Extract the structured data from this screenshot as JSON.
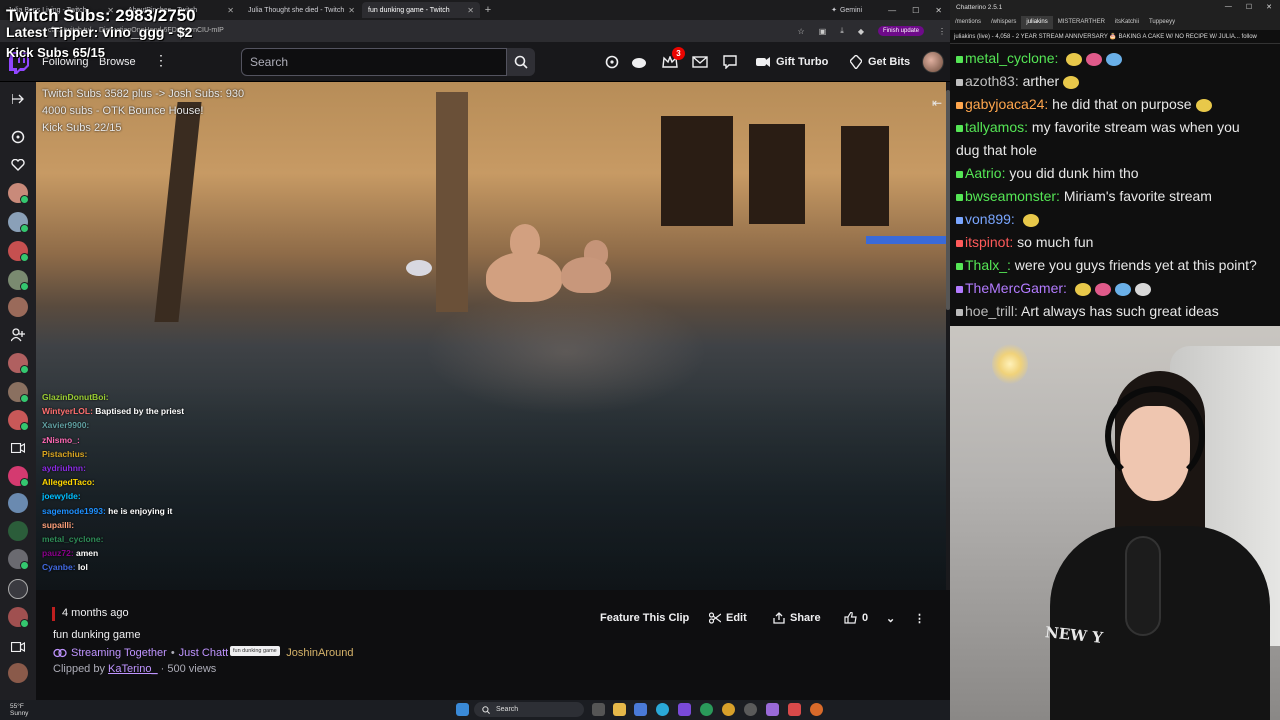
{
  "overlay": {
    "twitch_subs": "Twitch Subs: 2983/2750",
    "latest_tipper": "Latest Tipper: vino_ggg - $2",
    "kick_subs": "Kick Subs 65/15"
  },
  "browser": {
    "tabs": [
      {
        "label": "Julia Bops Living - Twitch",
        "active": false
      },
      {
        "label": "AboutPinches - Twitch",
        "active": false
      },
      {
        "label": "Julia Thought she died - Twitch",
        "active": false
      },
      {
        "label": "fun dunking game - Twitch",
        "active": true
      }
    ],
    "gemini_label": "Gemini",
    "url": "clips.twitch.tv/... DistinctionOneHand-6FDzloaznCIU-mIP",
    "finish_update_label": "Finish update"
  },
  "twitch_nav": {
    "following": "Following",
    "browse": "Browse",
    "search_placeholder": "Search",
    "notification_count": "3",
    "gift_turbo": "Gift Turbo",
    "get_bits": "Get Bits"
  },
  "video": {
    "overlay_lines": [
      "Twitch Subs 3582   plus -> Josh Subs: 930",
      "4000 subs - OTK Bounce House!",
      "Kick Subs 22/15"
    ],
    "chat": [
      {
        "user": "GlazinDonutBoi:",
        "msg": "",
        "color": "#9acd32"
      },
      {
        "user": "WintyerLOL:",
        "msg": "Baptised by the priest",
        "color": "#ff6f6f"
      },
      {
        "user": "Xavier9900:",
        "msg": "",
        "color": "#5f9ea0"
      },
      {
        "user": "zNismo_:",
        "msg": "",
        "color": "#ff69b4"
      },
      {
        "user": "Pistachius:",
        "msg": "",
        "color": "#daa520"
      },
      {
        "user": "aydriuhnn:",
        "msg": "",
        "color": "#8a2be2"
      },
      {
        "user": "AllegedTaco:",
        "msg": "",
        "color": "#ffd700"
      },
      {
        "user": "joewylde:",
        "msg": "",
        "color": "#00bfff"
      },
      {
        "user": "",
        "msg": "",
        "color": "#ff0000"
      },
      {
        "user": "sagemode1993:",
        "msg": "he is enjoying it",
        "color": "#1e90ff"
      },
      {
        "user": "supailli:",
        "msg": "",
        "color": "#ffa07a"
      },
      {
        "user": "metal_cyclone:",
        "msg": "",
        "color": "#2e8b57"
      },
      {
        "user": "pauz72:",
        "msg": "amen",
        "color": "#8b008b"
      },
      {
        "user": "Cyanbe:",
        "msg": "lol",
        "color": "#4169e1"
      }
    ]
  },
  "clip": {
    "age": "4 months ago",
    "title": "fun dunking game",
    "streaming_together": "Streaming Together",
    "category": "Just Chatt",
    "tooltip": "fun dunking game",
    "partner": "JoshinAround",
    "clipped_by_prefix": "Clipped by",
    "clipped_by": "KaTerino_",
    "views": "· 500 views",
    "feature_btn": "Feature This Clip",
    "edit_btn": "Edit",
    "share_btn": "Share",
    "like_count": "0"
  },
  "taskbar": {
    "weather_temp": "55°F",
    "weather_desc": "Sunny",
    "search": "Search"
  },
  "chatterino": {
    "title": "Chatterino 2.5.1",
    "tabs": [
      "/mentions",
      "/whispers",
      "juliakins",
      "MISTERARTHER",
      "itsKatchii",
      "Tuppeeyy"
    ],
    "active_tab": 2,
    "header": "juliakins (live) - 4,058 - 2 YEAR STREAM ANNIVERSARY 🎂 BAKING A CAKE W/ NO RECIPE W/ JULIA... follow",
    "messages": [
      {
        "user": "metal_cyclone:",
        "msg": "",
        "color": "#55e655",
        "emotes": 3
      },
      {
        "user": "azoth83:",
        "msg": "arther",
        "color": "#c0c0c0",
        "emotes": 1
      },
      {
        "user": "gabyjoaca24:",
        "msg": "he did that on purpose",
        "color": "#ffa64d",
        "emotes": 1
      },
      {
        "user": "tallyamos:",
        "msg": "my favorite stream was when you",
        "color": "#55e655",
        "emotes": 0
      },
      {
        "user": "",
        "msg": "dug that hole",
        "color": "#55e655",
        "emotes": 0
      },
      {
        "user": "Aatrio:",
        "msg": "you did dunk him tho",
        "color": "#55e655",
        "emotes": 0
      },
      {
        "user": "bwseamonster:",
        "msg": "Miriam's favorite stream",
        "color": "#55e655",
        "emotes": 0
      },
      {
        "user": "von899:",
        "msg": "",
        "color": "#7aa6ff",
        "emotes": 1
      },
      {
        "user": "itspinot:",
        "msg": "so much fun",
        "color": "#ff5a5a",
        "emotes": 0
      },
      {
        "user": "Thalx_:",
        "msg": "were you guys friends yet at this point?",
        "color": "#55e655",
        "emotes": 0
      },
      {
        "user": "TheMercGamer:",
        "msg": "",
        "color": "#b37bff",
        "emotes": 4
      },
      {
        "user": "hoe_trill:",
        "msg": "Art always has such great ideas",
        "color": "#bbbbbb",
        "emotes": 0
      }
    ]
  },
  "webcam": {
    "shirt_text": "NEW Y"
  }
}
